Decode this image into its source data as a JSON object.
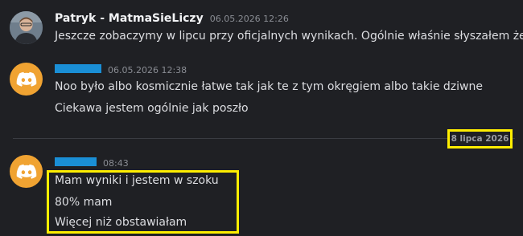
{
  "messages": [
    {
      "author": "Patryk - MatmaSieLiczy",
      "timestamp": "06.05.2026 12:26",
      "avatar_icon": "user-photo",
      "lines": [
        "Jeszcze zobaczymy w lipcu przy oficjalnych wynikach. Ogólnie właśnie słyszałem że nie"
      ]
    },
    {
      "author": "",
      "timestamp": "06.05.2026 12:38",
      "avatar_icon": "discord-icon",
      "lines": [
        "Noo było albo kosmicznie łatwe tak jak te z tym okręgiem albo takie dziwne",
        "Ciekawa jestem ogólnie jak poszło"
      ]
    },
    {
      "author": "",
      "timestamp": "08:43",
      "avatar_icon": "discord-icon",
      "lines": [
        "Mam wyniki i jestem w szoku",
        "80% mam",
        "Więcej niż obstawiałam"
      ]
    }
  ],
  "date_divider": "8 lipca 2026",
  "colors": {
    "background": "#1f2024",
    "discord_avatar": "#f0a332",
    "redaction": "#1a8fd6",
    "highlight": "#ffee00"
  }
}
